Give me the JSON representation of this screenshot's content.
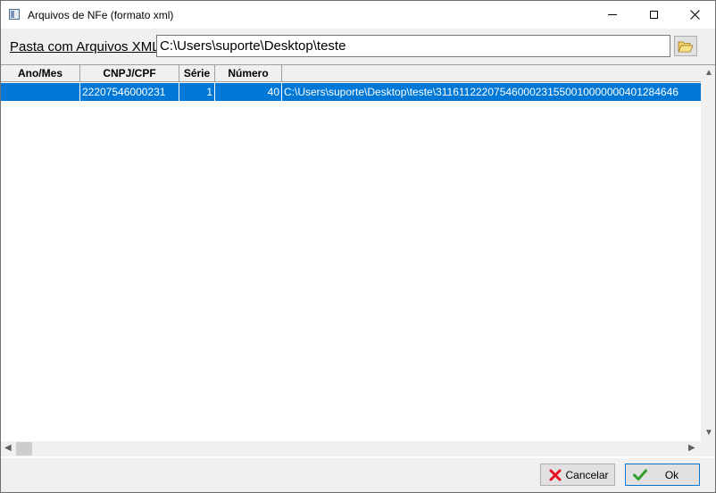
{
  "window": {
    "title": "Arquivos de NFe (formato xml)",
    "controls": {
      "minimize": "minimize",
      "maximize": "maximize",
      "close": "close"
    }
  },
  "folder": {
    "label": "Pasta com Arquivos XML",
    "value": "C:\\Users\\suporte\\Desktop\\teste",
    "browse_icon": "folder-open-icon"
  },
  "grid": {
    "columns": [
      "Ano/Mes",
      "CNPJ/CPF",
      "Série",
      "Número",
      ""
    ],
    "rows": [
      {
        "ano_mes": "",
        "cnpj_cpf": "22207546000231",
        "serie": "1",
        "numero": "40",
        "arquivo": "C:\\Users\\suporte\\Desktop\\teste\\31161122207546000231550010000000401284646"
      }
    ],
    "selected_row_color": "#0078d7"
  },
  "buttons": {
    "cancel_label": "Cancelar",
    "cancel_icon": "x-icon",
    "cancel_icon_color": "#e81123",
    "ok_label": "Ok",
    "ok_icon": "check-icon",
    "ok_icon_color": "#2e9e2e"
  }
}
